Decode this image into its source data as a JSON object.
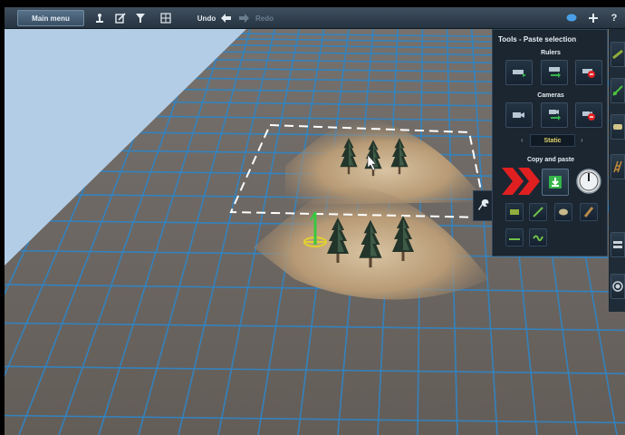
{
  "toolbar": {
    "main_menu_label": "Main menu",
    "undo_label": "Undo",
    "redo_label": "Redo",
    "icons": [
      "person-icon",
      "edit-icon",
      "filter-icon",
      "grid-icon",
      "undo-arrow-icon",
      "redo-arrow-icon",
      "chat-bubble-icon",
      "plus-icon",
      "help-icon"
    ]
  },
  "panel": {
    "title": "Tools - Paste selection",
    "rulers_label": "Rulers",
    "cameras_label": "Cameras",
    "camera_mode": "Static",
    "copy_paste_label": "Copy and paste",
    "arrow_left": "‹",
    "arrow_right": "›"
  },
  "colors": {
    "toolbar_bg": "#2f3d4a",
    "panel_bg": "#1b2631",
    "accent_green": "#34b44a",
    "accent_red": "#e02020",
    "static_text": "#e3d46b",
    "grid_line": "#2e86c8",
    "ground": "#6e6864",
    "sky": "#b4cde6"
  }
}
